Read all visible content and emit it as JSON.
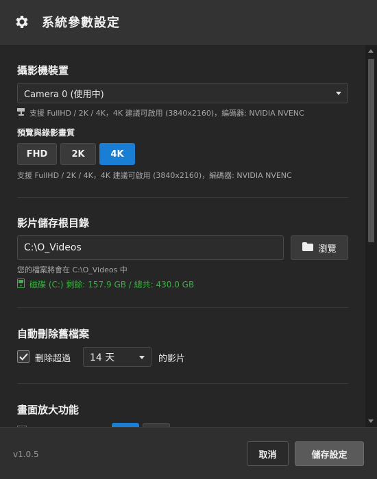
{
  "header": {
    "title": "系統參數設定",
    "icon": "gear-icon"
  },
  "camera": {
    "section_title": "攝影機裝置",
    "selected": "Camera 0 (使用中)",
    "support_hint": "支援 FullHD / 2K / 4K，4K 建議可啟用 (3840x2160)，編碼器: NVIDIA NVENC"
  },
  "quality": {
    "label": "預覽與錄影畫質",
    "options": [
      "FHD",
      "2K",
      "4K"
    ],
    "active": "4K",
    "support_hint": "支援 FullHD / 2K / 4K，4K 建議可啟用 (3840x2160)，編碼器: NVIDIA NVENC"
  },
  "storage": {
    "section_title": "影片儲存根目錄",
    "path": "C:\\O_Videos",
    "browse_label": "瀏覽",
    "save_hint": "您的檔案將會在 C:\\O_Videos 中",
    "disk_info": "磁碟 (C:) 剩餘: 157.9 GB / 總共: 430.0 GB",
    "disk_color": "#3cb043"
  },
  "auto_delete": {
    "section_title": "自動刪除舊檔案",
    "checkbox_label": "刪除超過",
    "checked": true,
    "days_selected": "14 天",
    "suffix": "的影片"
  },
  "zoom": {
    "section_title": "畫面放大功能"
  },
  "footer": {
    "version": "v1.0.5",
    "cancel_label": "取消",
    "save_label": "儲存設定"
  },
  "colors": {
    "accent": "#1a7fd4",
    "background": "#262626",
    "header": "#333333"
  }
}
